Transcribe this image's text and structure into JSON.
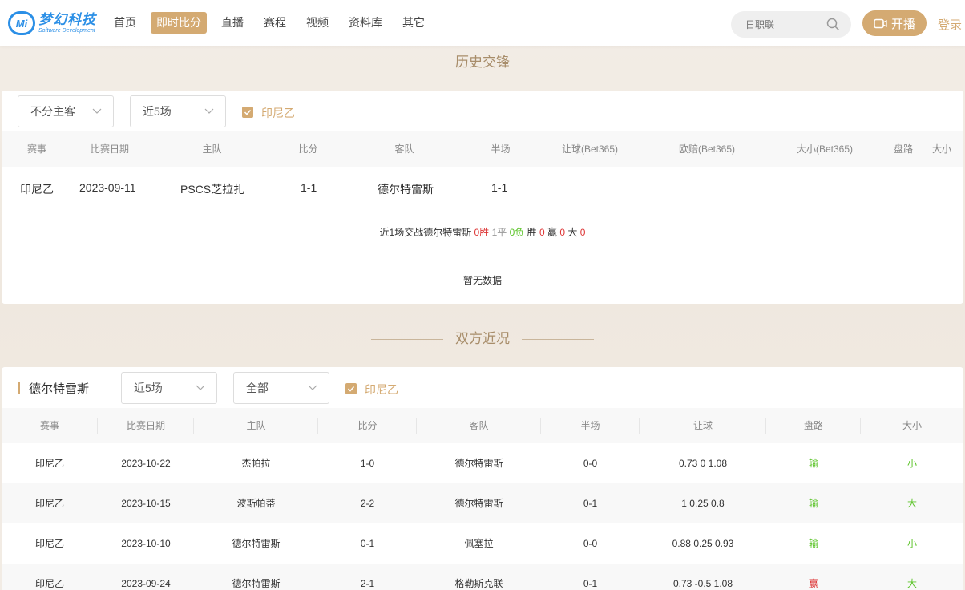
{
  "header": {
    "logo_badge": "Mi",
    "logo_cn": "梦幻科技",
    "logo_en": "Software Development",
    "nav": [
      "首页",
      "即时比分",
      "直播",
      "赛程",
      "视频",
      "资料库",
      "其它"
    ],
    "active_nav": "即时比分",
    "search_placeholder": "日职联",
    "kaibo_label": "开播",
    "login_label": "登录"
  },
  "history": {
    "title": "历史交锋",
    "filter_home_away": "不分主客",
    "filter_count": "近5场",
    "league_check": "印尼乙",
    "columns": [
      "赛事",
      "比赛日期",
      "主队",
      "比分",
      "客队",
      "半场",
      "让球(Bet365)",
      "欧赔(Bet365)",
      "大小(Bet365)",
      "盘路",
      "大小"
    ],
    "rows": [
      {
        "league": "印尼乙",
        "date": "2023-09-11",
        "home": "PSCS芝拉扎",
        "score": "1-1",
        "away": "德尔特雷斯",
        "half": "1-1"
      }
    ],
    "summary": {
      "prefix": "近1场交战德尔特雷斯",
      "win": "0胜",
      "draw": "1平",
      "lose": "0负",
      "sheng_label": "胜",
      "sheng": "0",
      "ying_label": "赢",
      "ying": "0",
      "da_label": "大",
      "da": "0"
    },
    "no_data": "暂无数据"
  },
  "recent": {
    "title": "双方近况",
    "team": "德尔特雷斯",
    "filter_count": "近5场",
    "filter_scope": "全部",
    "league_check": "印尼乙",
    "columns": [
      "赛事",
      "比赛日期",
      "主队",
      "比分",
      "客队",
      "半场",
      "让球",
      "盘路",
      "大小"
    ],
    "rows": [
      {
        "league": "印尼乙",
        "date": "2023-10-22",
        "home": "杰帕拉",
        "score": "1-0",
        "away": "德尔特雷斯",
        "half": "0-0",
        "handicap": "0.73 0 1.08",
        "pan": "输",
        "size": "小"
      },
      {
        "league": "印尼乙",
        "date": "2023-10-15",
        "home": "波斯帕蒂",
        "score": "2-2",
        "away": "德尔特雷斯",
        "half": "0-1",
        "handicap": "1 0.25 0.8",
        "pan": "输",
        "size": "大"
      },
      {
        "league": "印尼乙",
        "date": "2023-10-10",
        "home": "德尔特雷斯",
        "score": "0-1",
        "away": "佩塞拉",
        "half": "0-0",
        "handicap": "0.88 0.25 0.93",
        "pan": "输",
        "size": "小"
      },
      {
        "league": "印尼乙",
        "date": "2023-09-24",
        "home": "德尔特雷斯",
        "score": "2-1",
        "away": "格勒斯克联",
        "half": "0-1",
        "handicap": "0.73 -0.5 1.08",
        "pan": "赢",
        "size": "大"
      }
    ]
  },
  "colors": {
    "accent": "#d4aa72",
    "brand": "#2b8fe6",
    "win": "#d33",
    "lose": "#5cc42a"
  }
}
